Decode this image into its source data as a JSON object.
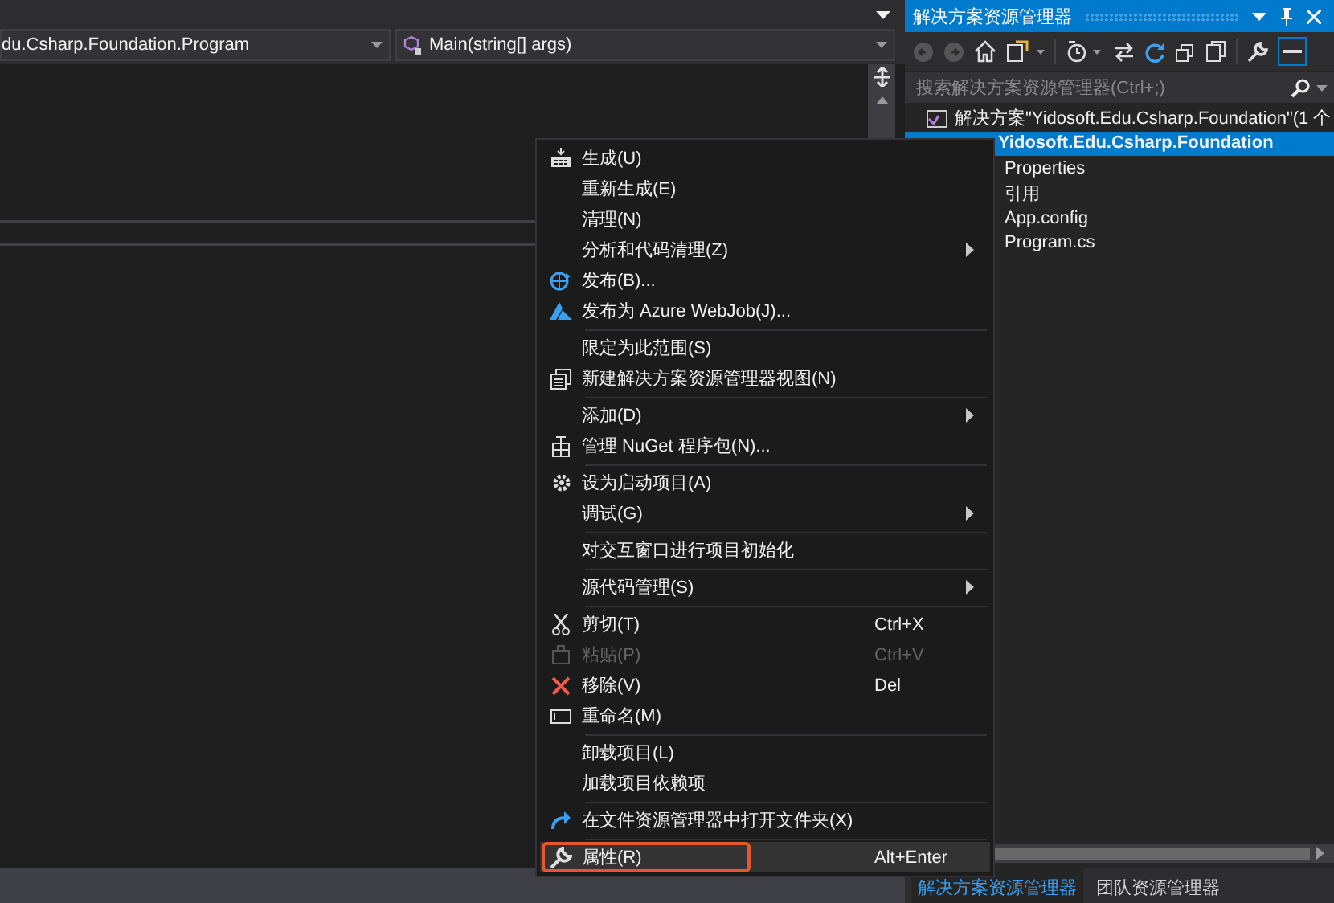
{
  "editor": {
    "type_combo": "du.Csharp.Foundation.Program",
    "member_combo": "Main(string[] args)"
  },
  "solution_explorer": {
    "title": "解决方案资源管理器",
    "search": {
      "placeholder": "搜索解决方案资源管理器(Ctrl+;)"
    },
    "tree": [
      {
        "label": "解决方案\"Yidosoft.Edu.Csharp.Foundation\"(1 个",
        "selected": false,
        "children": [
          {
            "label": "Yidosoft.Edu.Csharp.Foundation",
            "selected": true,
            "children": [
              {
                "label": "Properties",
                "selected": false
              },
              {
                "label": "引用",
                "selected": false
              },
              {
                "label": "App.config",
                "selected": false
              },
              {
                "label": "Program.cs",
                "selected": false
              }
            ]
          }
        ]
      }
    ],
    "bottom_tabs": [
      {
        "label": "解决方案资源管理器",
        "selected": true
      },
      {
        "label": "团队资源管理器",
        "selected": false
      }
    ]
  },
  "context_menu": [
    {
      "kind": "item",
      "label": "生成(U)",
      "disabled": false,
      "selected": false
    },
    {
      "kind": "item",
      "label": "重新生成(E)",
      "disabled": false,
      "selected": false
    },
    {
      "kind": "item",
      "label": "清理(N)",
      "disabled": false,
      "selected": false
    },
    {
      "kind": "item",
      "label": "分析和代码清理(Z)",
      "submenu": true,
      "disabled": false,
      "selected": false
    },
    {
      "kind": "item",
      "label": "发布(B)...",
      "disabled": false,
      "selected": false
    },
    {
      "kind": "item",
      "label": "发布为 Azure WebJob(J)...",
      "disabled": false,
      "selected": false
    },
    {
      "kind": "separator"
    },
    {
      "kind": "item",
      "label": "限定为此范围(S)",
      "disabled": false,
      "selected": false
    },
    {
      "kind": "item",
      "label": "新建解决方案资源管理器视图(N)",
      "disabled": false,
      "selected": false
    },
    {
      "kind": "separator"
    },
    {
      "kind": "item",
      "label": "添加(D)",
      "submenu": true,
      "disabled": false,
      "selected": false
    },
    {
      "kind": "item",
      "label": "管理 NuGet 程序包(N)...",
      "disabled": false,
      "selected": false
    },
    {
      "kind": "separator"
    },
    {
      "kind": "item",
      "label": "设为启动项目(A)",
      "disabled": false,
      "selected": false
    },
    {
      "kind": "item",
      "label": "调试(G)",
      "submenu": true,
      "disabled": false,
      "selected": false
    },
    {
      "kind": "separator"
    },
    {
      "kind": "item",
      "label": "对交互窗口进行项目初始化",
      "disabled": false,
      "selected": false
    },
    {
      "kind": "separator"
    },
    {
      "kind": "item",
      "label": "源代码管理(S)",
      "submenu": true,
      "disabled": false,
      "selected": false
    },
    {
      "kind": "separator"
    },
    {
      "kind": "item",
      "label": "剪切(T)",
      "shortcut": "Ctrl+X",
      "disabled": false,
      "selected": false
    },
    {
      "kind": "item",
      "label": "粘贴(P)",
      "shortcut": "Ctrl+V",
      "disabled": true,
      "selected": false
    },
    {
      "kind": "item",
      "label": "移除(V)",
      "shortcut": "Del",
      "disabled": false,
      "selected": false
    },
    {
      "kind": "item",
      "label": "重命名(M)",
      "disabled": false,
      "selected": false
    },
    {
      "kind": "separator"
    },
    {
      "kind": "item",
      "label": "卸载项目(L)",
      "disabled": false,
      "selected": false
    },
    {
      "kind": "item",
      "label": "加载项目依赖项",
      "disabled": false,
      "selected": false
    },
    {
      "kind": "separator"
    },
    {
      "kind": "item",
      "label": "在文件资源管理器中打开文件夹(X)",
      "disabled": false,
      "selected": false
    },
    {
      "kind": "separator"
    },
    {
      "kind": "item",
      "label": "属性(R)",
      "shortcut": "Alt+Enter",
      "disabled": false,
      "selected": true
    }
  ]
}
